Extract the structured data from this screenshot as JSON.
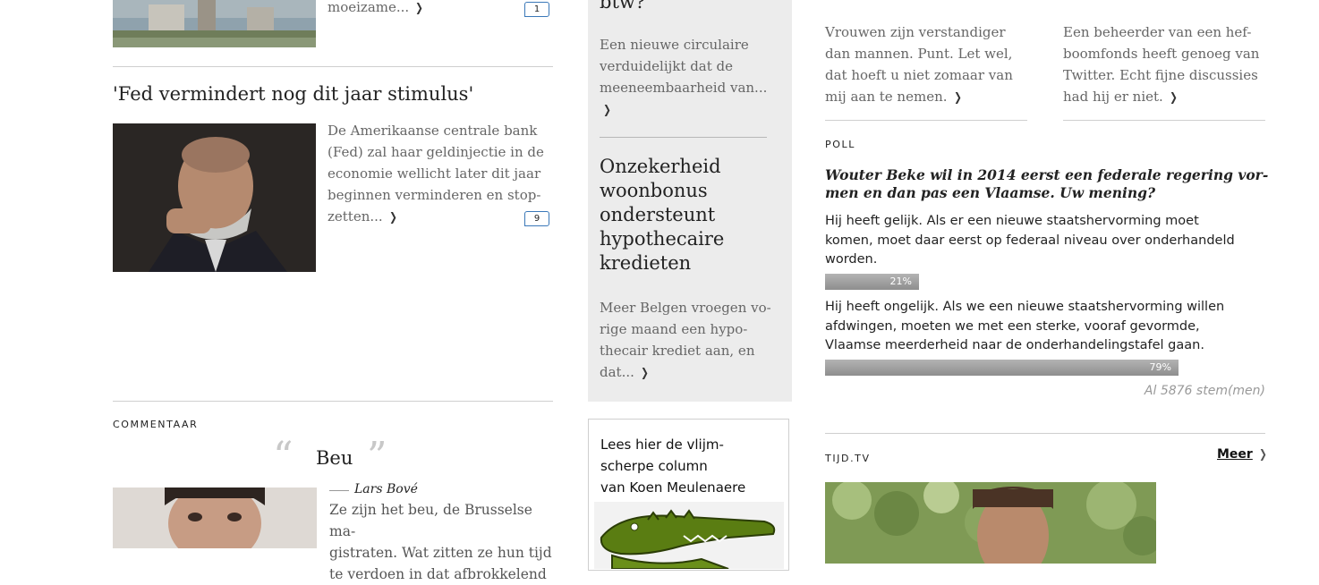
{
  "left": {
    "top_teaser_text": "moeizame...",
    "top_teaser_comments": "1",
    "fed": {
      "title": "'Fed vermindert nog dit jaar stimulus'",
      "lines": [
        "De Amerikaanse centrale bank",
        "(Fed) zal haar geldinjectie in de",
        "economie wellicht later dit jaar",
        "beginnen verminderen en stop-",
        "zetten..."
      ],
      "comments": "9"
    },
    "commentaar": {
      "label": "COMMENTAAR",
      "title": "Beu",
      "open_quote": "“",
      "close_quote": "”",
      "author": "Lars Bové",
      "lines": [
        "Ze zijn het beu, de Brusselse ma-",
        "gistraten. Wat zitten ze hun tijd",
        "te verdoen in dat afbrokkelend"
      ]
    }
  },
  "middle": {
    "top_heading_fragment": "btw?",
    "btw_lines": [
      "Een nieuwe circulaire",
      "verduidelijkt dat de",
      "meeneembaarheid van..."
    ],
    "woonbonus": {
      "title_lines": [
        "Onzekerheid",
        "woonbonus",
        "ondersteunt",
        "hypothecaire",
        "kredieten"
      ],
      "lines": [
        "Meer Belgen vroegen vo-",
        "rige maand een hypo-",
        "thecair krediet aan, en",
        "dat..."
      ]
    },
    "ad": {
      "lines": [
        "Lees hier de vlijm-",
        "scherpe column",
        "van Koen Meulenaere"
      ]
    }
  },
  "right": {
    "col1_lines": [
      "Vrouwen zijn verstandiger",
      "dan mannen. Punt. Let wel,",
      "dat hoeft u niet zomaar van",
      "mij aan te nemen."
    ],
    "col2_lines": [
      "Een beheerder van een hef-",
      "boomfonds heeft genoeg van",
      "Twitter. Echt fijne discussies",
      "had hij er niet."
    ],
    "poll": {
      "label": "POLL",
      "question_lines": [
        "Wouter Beke wil in 2014 eerst een federale regering vor-",
        "men en dan pas een Vlaamse. Uw mening?"
      ],
      "options": [
        {
          "lines": [
            "Hij heeft gelijk. Als er een nieuwe staatshervorming moet",
            "komen, moet daar eerst op federaal niveau over onderhandeld",
            "worden."
          ],
          "percent_label": "21%",
          "percent": 21
        },
        {
          "lines": [
            "Hij heeft ongelijk. Als we een nieuwe staatshervorming willen",
            "afdwingen, moeten we met een sterke, vooraf gevormde,",
            "Vlaamse meerderheid naar de onderhandelingstafel gaan."
          ],
          "percent_label": "79%",
          "percent": 79
        }
      ],
      "votes": "Al 5876 stem(men)"
    },
    "tijdtv": {
      "label": "TIJD.TV",
      "more": "Meer"
    }
  }
}
